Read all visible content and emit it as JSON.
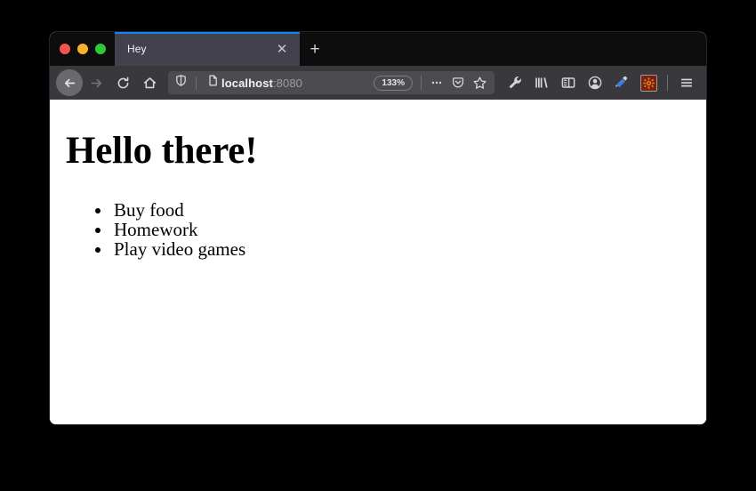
{
  "window": {
    "traffic_lights": [
      {
        "name": "close",
        "color": "#f9554f"
      },
      {
        "name": "minimize",
        "color": "#f9b229"
      },
      {
        "name": "zoom",
        "color": "#2ec939"
      }
    ]
  },
  "tabbar": {
    "active_tab_title": "Hey",
    "close_tab_glyph": "✕",
    "new_tab_glyph": "+",
    "active_tab_accent": "#0a84ff"
  },
  "navbar": {
    "back_label": "Back",
    "forward_label": "Forward",
    "reload_label": "Reload",
    "home_label": "Home"
  },
  "urlbar": {
    "url_host": "localhost",
    "url_port": ":8080",
    "zoom_level": "133%",
    "page_actions_glyph": "•••",
    "shield_label": "Tracking Protection",
    "page_icon_label": "Page Info",
    "pocket_label": "Save to Pocket",
    "bookmark_label": "Bookmark this page"
  },
  "toolbar": {
    "buttons": [
      {
        "name": "wrench-icon",
        "label": "Developer Tools"
      },
      {
        "name": "library-icon",
        "label": "Library"
      },
      {
        "name": "sidebar-icon",
        "label": "Sidebars"
      },
      {
        "name": "account-icon",
        "label": "Account"
      },
      {
        "name": "eyedropper-icon",
        "label": "Eyedropper"
      },
      {
        "name": "extension-icon",
        "label": "Extension"
      },
      {
        "name": "menu-icon",
        "label": "Open Application Menu"
      }
    ],
    "extension_bg": "#7a1f12",
    "extension_fg": "#e8911a"
  },
  "page": {
    "heading": "Hello there!",
    "list_items": [
      "Buy food",
      "Homework",
      "Play video games"
    ]
  }
}
